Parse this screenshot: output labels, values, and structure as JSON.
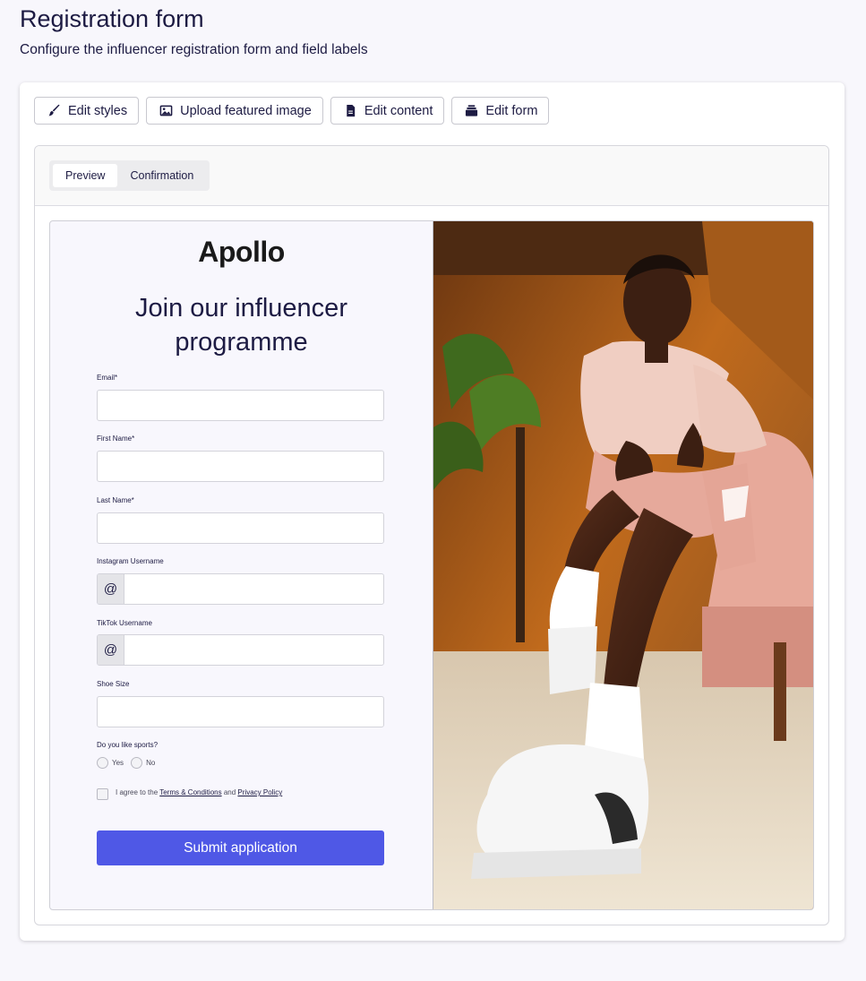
{
  "header": {
    "title": "Registration form",
    "subtitle": "Configure the influencer registration form and field labels"
  },
  "toolbar": {
    "edit_styles": "Edit styles",
    "upload_image": "Upload featured image",
    "edit_content": "Edit content",
    "edit_form": "Edit form"
  },
  "tabs": [
    "Preview",
    "Confirmation"
  ],
  "active_tab": "Preview",
  "form": {
    "brand": "Apollo",
    "headline": "Join our influencer programme",
    "fields": [
      {
        "label": "Email*",
        "value": "",
        "prefix": ""
      },
      {
        "label": "First Name*",
        "value": "",
        "prefix": ""
      },
      {
        "label": "Last Name*",
        "value": "",
        "prefix": ""
      },
      {
        "label": "Instagram Username",
        "value": "",
        "prefix": "@"
      },
      {
        "label": "TikTok Username",
        "value": "",
        "prefix": "@"
      },
      {
        "label": "Shoe Size",
        "value": "",
        "prefix": ""
      }
    ],
    "question": {
      "label": "Do you like sports?",
      "options": [
        "Yes",
        "No"
      ]
    },
    "agreement": {
      "prefix": "I agree to the",
      "terms": "Terms & Conditions",
      "and": "and",
      "privacy": "Privacy Policy"
    },
    "submit": "Submit application"
  },
  "featured_image": {
    "description": "Featured image: person seated in a pink chair wearing pink athletic wear and white sneakers"
  },
  "colors": {
    "primary": "#4f58e6",
    "text": "#1d1b43",
    "background": "#f8f7fc"
  }
}
